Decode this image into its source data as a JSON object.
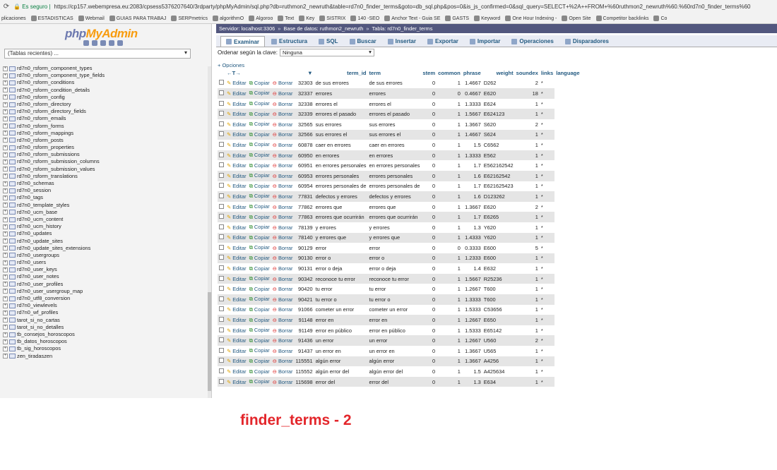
{
  "browser": {
    "secure_label": "Es seguro",
    "url": "https://cp157.webempresa.eu:2083/cpsess5376207640/3rdparty/phpMyAdmin/sql.php?db=ruthmon2_newruth&table=rd7n0_finder_terms&goto=db_sql.php&pos=0&is_js_confirmed=0&sql_query=SELECT+%2A++FROM+%60ruthmon2_newruth%60.%60rd7n0_finder_terms%60",
    "bookmarks": [
      "plicaciones",
      "ESTADISTICAS",
      "Webmail",
      "GUIAS PARA TRABAJ",
      "SERPmetrics",
      "algorithmO",
      "Algoroo",
      "Text",
      "Key",
      "SISTRIX",
      "140 -SEO",
      "Anchor Text - Guia SE",
      "GASTS",
      "Keyword",
      "One Hour Indexing -",
      "Open Site",
      "Competitor backlinks",
      "Co"
    ]
  },
  "nav": {
    "logo_php": "php",
    "logo_myadmin": "MyAdmin",
    "recent": "(Tablas recientes) ...",
    "tables": [
      "rd7n0_rsform_component_types",
      "rd7n0_rsform_component_type_fields",
      "rd7n0_rsform_conditions",
      "rd7n0_rsform_condition_details",
      "rd7n0_rsform_config",
      "rd7n0_rsform_directory",
      "rd7n0_rsform_directory_fields",
      "rd7n0_rsform_emails",
      "rd7n0_rsform_forms",
      "rd7n0_rsform_mappings",
      "rd7n0_rsform_posts",
      "rd7n0_rsform_properties",
      "rd7n0_rsform_submissions",
      "rd7n0_rsform_submission_columns",
      "rd7n0_rsform_submission_values",
      "rd7n0_rsform_translations",
      "rd7n0_schemas",
      "rd7n0_session",
      "rd7n0_tags",
      "rd7n0_template_styles",
      "rd7n0_ucm_base",
      "rd7n0_ucm_content",
      "rd7n0_ucm_history",
      "rd7n0_updates",
      "rd7n0_update_sites",
      "rd7n0_update_sites_extensions",
      "rd7n0_usergroups",
      "rd7n0_users",
      "rd7n0_user_keys",
      "rd7n0_user_notes",
      "rd7n0_user_profiles",
      "rd7n0_user_usergroup_map",
      "rd7n0_utf8_conversion",
      "rd7n0_viewlevels",
      "rd7n0_wf_profiles",
      "tarot_si_no_cartas",
      "tarot_si_no_detalles",
      "tb_consejos_horoscopos",
      "tb_datos_horoscopos",
      "tb_sig_horoscopos",
      "zen_tiradaszen"
    ]
  },
  "breadcrumb": {
    "server": "Servidor: localhost:3306",
    "database": "Base de datos: ruthmon2_newruth",
    "table": "Tabla: rd7n0_finder_terms"
  },
  "tabs": [
    "Examinar",
    "Estructura",
    "SQL",
    "Buscar",
    "Insertar",
    "Exportar",
    "Importar",
    "Operaciones",
    "Disparadores"
  ],
  "sort": {
    "label": "Ordenar según la clave:",
    "value": "Ninguna"
  },
  "options_label": "+ Opciones",
  "actions": {
    "edit": "Editar",
    "copy": "Copiar",
    "delete": "Borrar"
  },
  "columns": [
    "term_id",
    "term",
    "stem",
    "common",
    "phrase",
    "weight",
    "soundex",
    "links",
    "language"
  ],
  "rows": [
    [
      "32303",
      "de sus errores",
      "de sus errores",
      "0",
      "1",
      "1.4667",
      "D262",
      "2",
      "*"
    ],
    [
      "32337",
      "errores",
      "errores",
      "0",
      "0",
      "0.4667",
      "E620",
      "18",
      "*"
    ],
    [
      "32338",
      "errores el",
      "errores el",
      "0",
      "1",
      "1.3333",
      "E624",
      "1",
      "*"
    ],
    [
      "32339",
      "errores el pasado",
      "errores el pasado",
      "0",
      "1",
      "1.5667",
      "E624123",
      "1",
      "*"
    ],
    [
      "32565",
      "sus errores",
      "sus errores",
      "0",
      "1",
      "1.3667",
      "S620",
      "2",
      "*"
    ],
    [
      "32566",
      "sus errores el",
      "sus errores el",
      "0",
      "1",
      "1.4667",
      "S624",
      "1",
      "*"
    ],
    [
      "60878",
      "caer en errores",
      "caer en errores",
      "0",
      "1",
      "1.5",
      "C6562",
      "1",
      "*"
    ],
    [
      "60950",
      "en errores",
      "en errores",
      "0",
      "1",
      "1.3333",
      "E562",
      "1",
      "*"
    ],
    [
      "60951",
      "en errores personales",
      "en errores personales",
      "0",
      "1",
      "1.7",
      "E562162542",
      "1",
      "*"
    ],
    [
      "60953",
      "errores personales",
      "errores personales",
      "0",
      "1",
      "1.6",
      "E62162542",
      "1",
      "*"
    ],
    [
      "60954",
      "errores personales de",
      "errores personales de",
      "0",
      "1",
      "1.7",
      "E621625423",
      "1",
      "*"
    ],
    [
      "77831",
      "defectos y errores",
      "defectos y errores",
      "0",
      "1",
      "1.6",
      "D123262",
      "1",
      "*"
    ],
    [
      "77862",
      "errores que",
      "errores que",
      "0",
      "1",
      "1.3667",
      "E620",
      "2",
      "*"
    ],
    [
      "77863",
      "errores que ocurrirán",
      "errores que ocurrirán",
      "0",
      "1",
      "1.7",
      "E6265",
      "1",
      "*"
    ],
    [
      "78139",
      "y errores",
      "y errores",
      "0",
      "1",
      "1.3",
      "Y620",
      "1",
      "*"
    ],
    [
      "78140",
      "y errores que",
      "y errores que",
      "0",
      "1",
      "1.4333",
      "Y620",
      "1",
      "*"
    ],
    [
      "90129",
      "error",
      "error",
      "0",
      "0",
      "0.3333",
      "E600",
      "5",
      "*"
    ],
    [
      "90130",
      "error o",
      "error o",
      "0",
      "1",
      "1.2333",
      "E600",
      "1",
      "*"
    ],
    [
      "90131",
      "error o deja",
      "error o deja",
      "0",
      "1",
      "1.4",
      "E632",
      "1",
      "*"
    ],
    [
      "90342",
      "reconoce tu error",
      "reconoce tu error",
      "0",
      "1",
      "1.5667",
      "R25236",
      "1",
      "*"
    ],
    [
      "90420",
      "tu error",
      "tu error",
      "0",
      "1",
      "1.2667",
      "T600",
      "1",
      "*"
    ],
    [
      "90421",
      "tu error o",
      "tu error o",
      "0",
      "1",
      "1.3333",
      "T600",
      "1",
      "*"
    ],
    [
      "91066",
      "cometer un error",
      "cometer un error",
      "0",
      "1",
      "1.5333",
      "C53656",
      "1",
      "*"
    ],
    [
      "91148",
      "error en",
      "error en",
      "0",
      "1",
      "1.2667",
      "E650",
      "1",
      "*"
    ],
    [
      "91149",
      "error en público",
      "error en público",
      "0",
      "1",
      "1.5333",
      "E65142",
      "1",
      "*"
    ],
    [
      "91436",
      "un error",
      "un error",
      "0",
      "1",
      "1.2667",
      "U560",
      "2",
      "*"
    ],
    [
      "91437",
      "un error en",
      "un error en",
      "0",
      "1",
      "1.3667",
      "U565",
      "1",
      "*"
    ],
    [
      "115551",
      "algún error",
      "algún error",
      "0",
      "1",
      "1.3667",
      "A4256",
      "1",
      "*"
    ],
    [
      "115552",
      "algún error del",
      "algún error del",
      "0",
      "1",
      "1.5",
      "A425634",
      "1",
      "*"
    ],
    [
      "115698",
      "error del",
      "error del",
      "0",
      "1",
      "1.3",
      "E634",
      "1",
      "*"
    ]
  ],
  "caption": "finder_terms - 2"
}
